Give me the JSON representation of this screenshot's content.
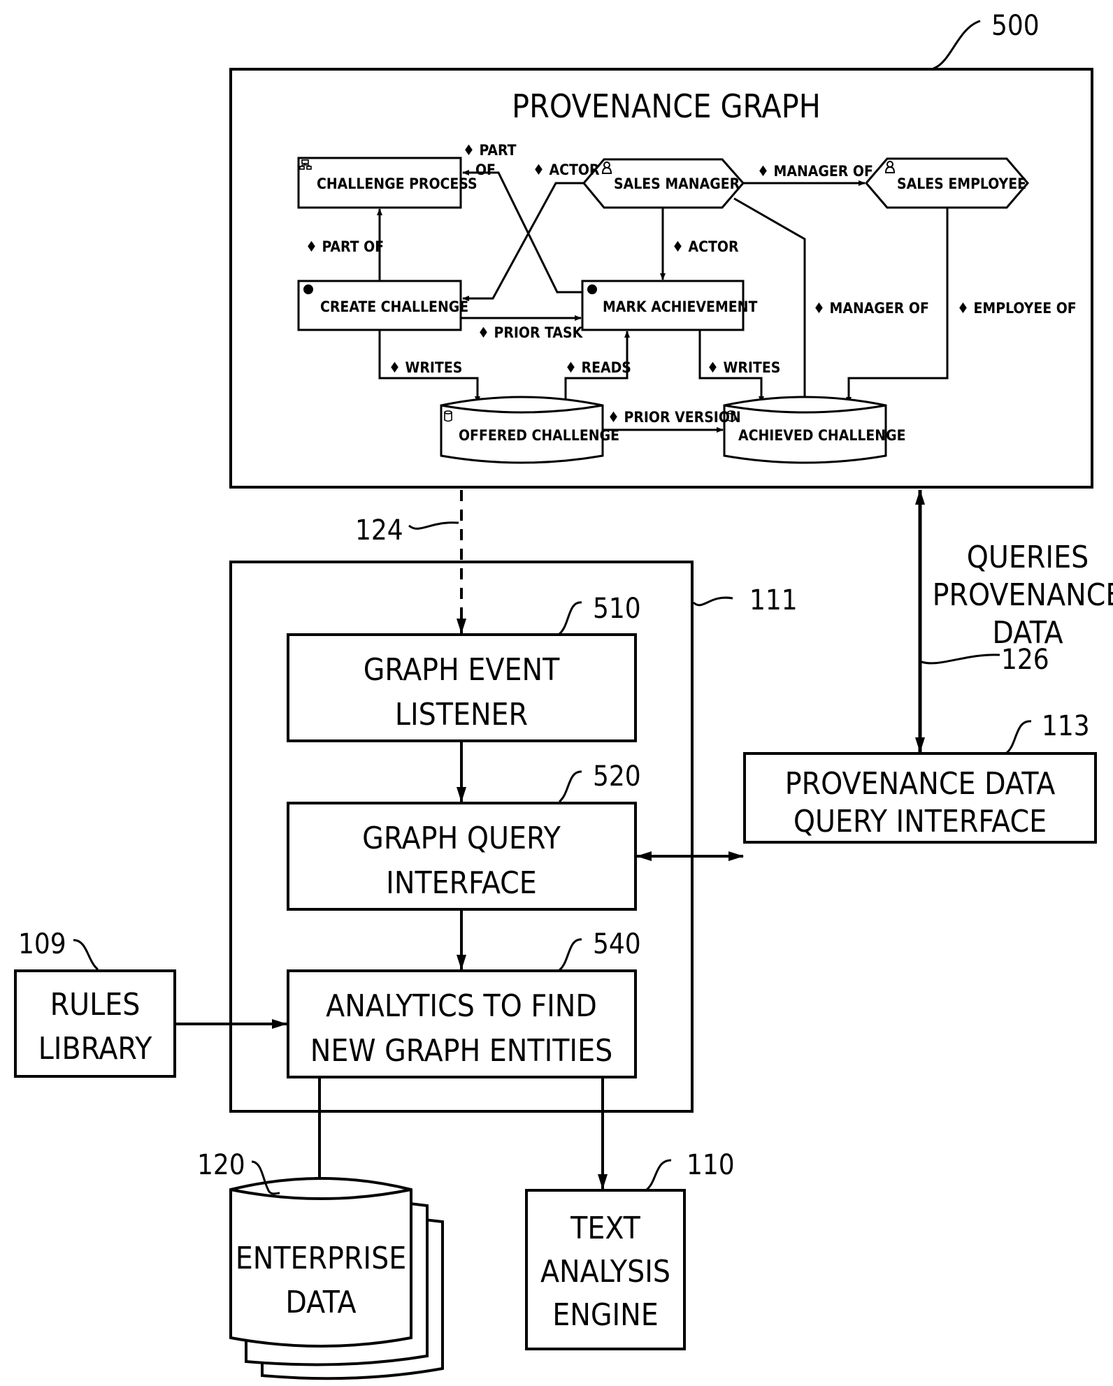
{
  "figure": {
    "ref_graph": "500",
    "ref_process_box": "111",
    "ref_event_link": "124",
    "ref_query_link": "126",
    "ref_query_interface": "113",
    "ref_rules": "109",
    "ref_enterprise": "120",
    "ref_text_engine": "110",
    "ref_listener": "510",
    "ref_graph_query": "520",
    "ref_analytics": "540"
  },
  "graph": {
    "title": "PROVENANCE  GRAPH",
    "nodes": {
      "challenge_process": {
        "label": "CHALLENGE  PROCESS",
        "icon": "process-icon"
      },
      "create_challenge": {
        "label": "CREATE  CHALLENGE",
        "icon": "task-icon"
      },
      "mark_achievement": {
        "label": "MARK  ACHIEVEMENT",
        "icon": "task-icon"
      },
      "sales_manager": {
        "label": "SALES  MANAGER",
        "icon": "person-icon"
      },
      "sales_employee": {
        "label": "SALES  EMPLOYEE",
        "icon": "person-icon"
      },
      "offered_challenge": {
        "label": "OFFERED  CHALLENGE",
        "icon": "database-icon"
      },
      "achieved_challenge": {
        "label": "ACHIEVED  CHALLENGE",
        "icon": "database-icon"
      }
    },
    "edges": {
      "part_of_top_1": "♦ PART",
      "part_of_top_2": "OF",
      "actor_top": "♦ ACTOR",
      "manager_of_top": "♦ MANAGER  OF",
      "part_of_left": "♦ PART  OF",
      "actor_mid": "♦ ACTOR",
      "manager_of_right": "♦ MANAGER  OF",
      "employee_of": "♦ EMPLOYEE  OF",
      "prior_task": "♦ PRIOR  TASK",
      "writes_left": "♦ WRITES",
      "reads": "♦ READS",
      "writes_right": "♦ WRITES",
      "prior_version": "♦ PRIOR  VERSION"
    }
  },
  "blocks": {
    "listener": [
      "GRAPH  EVENT",
      "LISTENER"
    ],
    "graph_query": [
      "GRAPH  QUERY",
      "INTERFACE"
    ],
    "analytics": [
      "ANALYTICS  TO  FIND",
      "NEW  GRAPH  ENTITIES"
    ],
    "query_interface": [
      "PROVENANCE  DATA",
      "QUERY  INTERFACE"
    ],
    "rules": [
      "RULES",
      "LIBRARY"
    ],
    "enterprise": [
      "ENTERPRISE",
      "DATA"
    ],
    "text_engine": [
      "TEXT",
      "ANALYSIS",
      "ENGINE"
    ],
    "queries_label": [
      "QUERIES",
      "PROVENANCE",
      "DATA"
    ]
  }
}
